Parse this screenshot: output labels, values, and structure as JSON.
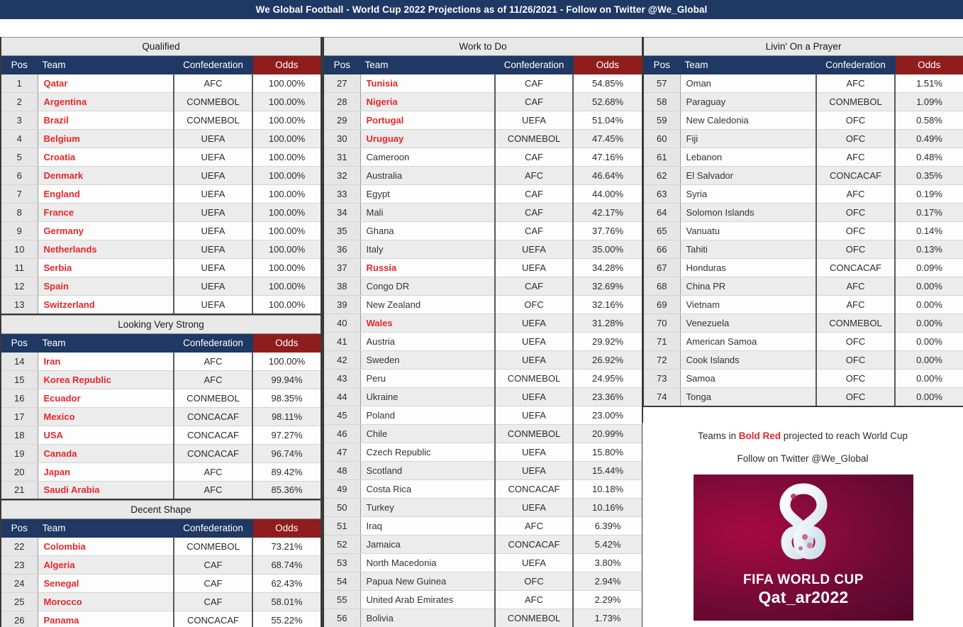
{
  "title": "We Global Football - World Cup 2022 Projections as of 11/26/2021 - Follow on Twitter @We_Global",
  "colors": {
    "header_blue": "#1f3864",
    "odds_red": "#8f1d1d",
    "bold_red": "#e8262a",
    "section_band": "#e8e8e8",
    "row_alt": "#ececec"
  },
  "columns": {
    "pos": "Pos",
    "team": "Team",
    "confederation": "Confederation",
    "odds": "Odds"
  },
  "sections": [
    {
      "name": "Qualified",
      "column": "left",
      "rows": [
        {
          "pos": "1",
          "team": "Qatar",
          "conf": "AFC",
          "odds": "100.00%",
          "red": true
        },
        {
          "pos": "2",
          "team": "Argentina",
          "conf": "CONMEBOL",
          "odds": "100.00%",
          "red": true
        },
        {
          "pos": "3",
          "team": "Brazil",
          "conf": "CONMEBOL",
          "odds": "100.00%",
          "red": true
        },
        {
          "pos": "4",
          "team": "Belgium",
          "conf": "UEFA",
          "odds": "100.00%",
          "red": true
        },
        {
          "pos": "5",
          "team": "Croatia",
          "conf": "UEFA",
          "odds": "100.00%",
          "red": true
        },
        {
          "pos": "6",
          "team": "Denmark",
          "conf": "UEFA",
          "odds": "100.00%",
          "red": true
        },
        {
          "pos": "7",
          "team": "England",
          "conf": "UEFA",
          "odds": "100.00%",
          "red": true
        },
        {
          "pos": "8",
          "team": "France",
          "conf": "UEFA",
          "odds": "100.00%",
          "red": true
        },
        {
          "pos": "9",
          "team": "Germany",
          "conf": "UEFA",
          "odds": "100.00%",
          "red": true
        },
        {
          "pos": "10",
          "team": "Netherlands",
          "conf": "UEFA",
          "odds": "100.00%",
          "red": true
        },
        {
          "pos": "11",
          "team": "Serbia",
          "conf": "UEFA",
          "odds": "100.00%",
          "red": true
        },
        {
          "pos": "12",
          "team": "Spain",
          "conf": "UEFA",
          "odds": "100.00%",
          "red": true
        },
        {
          "pos": "13",
          "team": "Switzerland",
          "conf": "UEFA",
          "odds": "100.00%",
          "red": true
        }
      ]
    },
    {
      "name": "Looking Very Strong",
      "column": "left",
      "rows": [
        {
          "pos": "14",
          "team": "Iran",
          "conf": "AFC",
          "odds": "100.00%",
          "red": true
        },
        {
          "pos": "15",
          "team": "Korea Republic",
          "conf": "AFC",
          "odds": "99.94%",
          "red": true
        },
        {
          "pos": "16",
          "team": "Ecuador",
          "conf": "CONMEBOL",
          "odds": "98.35%",
          "red": true
        },
        {
          "pos": "17",
          "team": "Mexico",
          "conf": "CONCACAF",
          "odds": "98.11%",
          "red": true
        },
        {
          "pos": "18",
          "team": "USA",
          "conf": "CONCACAF",
          "odds": "97.27%",
          "red": true
        },
        {
          "pos": "19",
          "team": "Canada",
          "conf": "CONCACAF",
          "odds": "96.74%",
          "red": true
        },
        {
          "pos": "20",
          "team": "Japan",
          "conf": "AFC",
          "odds": "89.42%",
          "red": true
        },
        {
          "pos": "21",
          "team": "Saudi Arabia",
          "conf": "AFC",
          "odds": "85.36%",
          "red": true
        }
      ]
    },
    {
      "name": "Decent Shape",
      "column": "left",
      "rows": [
        {
          "pos": "22",
          "team": "Colombia",
          "conf": "CONMEBOL",
          "odds": "73.21%",
          "red": true
        },
        {
          "pos": "23",
          "team": "Algeria",
          "conf": "CAF",
          "odds": "68.74%",
          "red": true
        },
        {
          "pos": "24",
          "team": "Senegal",
          "conf": "CAF",
          "odds": "62.43%",
          "red": true
        },
        {
          "pos": "25",
          "team": "Morocco",
          "conf": "CAF",
          "odds": "58.01%",
          "red": true
        },
        {
          "pos": "26",
          "team": "Panama",
          "conf": "CONCACAF",
          "odds": "55.22%",
          "red": true
        }
      ]
    },
    {
      "name": "Work to Do",
      "column": "mid",
      "rows": [
        {
          "pos": "27",
          "team": "Tunisia",
          "conf": "CAF",
          "odds": "54.85%",
          "red": true
        },
        {
          "pos": "28",
          "team": "Nigeria",
          "conf": "CAF",
          "odds": "52.68%",
          "red": true
        },
        {
          "pos": "29",
          "team": "Portugal",
          "conf": "UEFA",
          "odds": "51.04%",
          "red": true
        },
        {
          "pos": "30",
          "team": "Uruguay",
          "conf": "CONMEBOL",
          "odds": "47.45%",
          "red": true
        },
        {
          "pos": "31",
          "team": "Cameroon",
          "conf": "CAF",
          "odds": "47.16%",
          "red": false
        },
        {
          "pos": "32",
          "team": "Australia",
          "conf": "AFC",
          "odds": "46.64%",
          "red": false
        },
        {
          "pos": "33",
          "team": "Egypt",
          "conf": "CAF",
          "odds": "44.00%",
          "red": false
        },
        {
          "pos": "34",
          "team": "Mali",
          "conf": "CAF",
          "odds": "42.17%",
          "red": false
        },
        {
          "pos": "35",
          "team": "Ghana",
          "conf": "CAF",
          "odds": "37.76%",
          "red": false
        },
        {
          "pos": "36",
          "team": "Italy",
          "conf": "UEFA",
          "odds": "35.00%",
          "red": false
        },
        {
          "pos": "37",
          "team": "Russia",
          "conf": "UEFA",
          "odds": "34.28%",
          "red": true
        },
        {
          "pos": "38",
          "team": "Congo DR",
          "conf": "CAF",
          "odds": "32.69%",
          "red": false
        },
        {
          "pos": "39",
          "team": "New Zealand",
          "conf": "OFC",
          "odds": "32.16%",
          "red": false
        },
        {
          "pos": "40",
          "team": "Wales",
          "conf": "UEFA",
          "odds": "31.28%",
          "red": true
        },
        {
          "pos": "41",
          "team": "Austria",
          "conf": "UEFA",
          "odds": "29.92%",
          "red": false
        },
        {
          "pos": "42",
          "team": "Sweden",
          "conf": "UEFA",
          "odds": "26.92%",
          "red": false
        },
        {
          "pos": "43",
          "team": "Peru",
          "conf": "CONMEBOL",
          "odds": "24.95%",
          "red": false
        },
        {
          "pos": "44",
          "team": "Ukraine",
          "conf": "UEFA",
          "odds": "23.36%",
          "red": false
        },
        {
          "pos": "45",
          "team": "Poland",
          "conf": "UEFA",
          "odds": "23.00%",
          "red": false
        },
        {
          "pos": "46",
          "team": "Chile",
          "conf": "CONMEBOL",
          "odds": "20.99%",
          "red": false
        },
        {
          "pos": "47",
          "team": "Czech Republic",
          "conf": "UEFA",
          "odds": "15.80%",
          "red": false
        },
        {
          "pos": "48",
          "team": "Scotland",
          "conf": "UEFA",
          "odds": "15.44%",
          "red": false
        },
        {
          "pos": "49",
          "team": "Costa Rica",
          "conf": "CONCACAF",
          "odds": "10.18%",
          "red": false
        },
        {
          "pos": "50",
          "team": "Turkey",
          "conf": "UEFA",
          "odds": "10.16%",
          "red": false
        },
        {
          "pos": "51",
          "team": "Iraq",
          "conf": "AFC",
          "odds": "6.39%",
          "red": false
        },
        {
          "pos": "52",
          "team": "Jamaica",
          "conf": "CONCACAF",
          "odds": "5.42%",
          "red": false
        },
        {
          "pos": "53",
          "team": "North Macedonia",
          "conf": "UEFA",
          "odds": "3.80%",
          "red": false
        },
        {
          "pos": "54",
          "team": "Papua New Guinea",
          "conf": "OFC",
          "odds": "2.94%",
          "red": false
        },
        {
          "pos": "55",
          "team": "United Arab Emirates",
          "conf": "AFC",
          "odds": "2.29%",
          "red": false
        },
        {
          "pos": "56",
          "team": "Bolivia",
          "conf": "CONMEBOL",
          "odds": "1.73%",
          "red": false
        }
      ]
    },
    {
      "name": "Livin' On a Prayer",
      "column": "right",
      "rows": [
        {
          "pos": "57",
          "team": "Oman",
          "conf": "AFC",
          "odds": "1.51%",
          "red": false
        },
        {
          "pos": "58",
          "team": "Paraguay",
          "conf": "CONMEBOL",
          "odds": "1.09%",
          "red": false
        },
        {
          "pos": "59",
          "team": "New Caledonia",
          "conf": "OFC",
          "odds": "0.58%",
          "red": false
        },
        {
          "pos": "60",
          "team": "Fiji",
          "conf": "OFC",
          "odds": "0.49%",
          "red": false
        },
        {
          "pos": "61",
          "team": "Lebanon",
          "conf": "AFC",
          "odds": "0.48%",
          "red": false
        },
        {
          "pos": "62",
          "team": "El Salvador",
          "conf": "CONCACAF",
          "odds": "0.35%",
          "red": false
        },
        {
          "pos": "63",
          "team": "Syria",
          "conf": "AFC",
          "odds": "0.19%",
          "red": false
        },
        {
          "pos": "64",
          "team": "Solomon Islands",
          "conf": "OFC",
          "odds": "0.17%",
          "red": false
        },
        {
          "pos": "65",
          "team": "Vanuatu",
          "conf": "OFC",
          "odds": "0.14%",
          "red": false
        },
        {
          "pos": "66",
          "team": "Tahiti",
          "conf": "OFC",
          "odds": "0.13%",
          "red": false
        },
        {
          "pos": "67",
          "team": "Honduras",
          "conf": "CONCACAF",
          "odds": "0.09%",
          "red": false
        },
        {
          "pos": "68",
          "team": "China PR",
          "conf": "AFC",
          "odds": "0.00%",
          "red": false
        },
        {
          "pos": "69",
          "team": "Vietnam",
          "conf": "AFC",
          "odds": "0.00%",
          "red": false
        },
        {
          "pos": "70",
          "team": "Venezuela",
          "conf": "CONMEBOL",
          "odds": "0.00%",
          "red": false
        },
        {
          "pos": "71",
          "team": "American Samoa",
          "conf": "OFC",
          "odds": "0.00%",
          "red": false
        },
        {
          "pos": "72",
          "team": "Cook Islands",
          "conf": "OFC",
          "odds": "0.00%",
          "red": false
        },
        {
          "pos": "73",
          "team": "Samoa",
          "conf": "OFC",
          "odds": "0.00%",
          "red": false
        },
        {
          "pos": "74",
          "team": "Tonga",
          "conf": "OFC",
          "odds": "0.00%",
          "red": false
        }
      ]
    }
  ],
  "footer": {
    "note_prefix": "Teams in ",
    "note_highlight": "Bold Red",
    "note_suffix": " projected to reach World Cup",
    "note_line2": "Follow on Twitter @We_Global",
    "logo": {
      "line1": "FIFA WORLD CUP",
      "line2": "Qat_ar2022"
    }
  }
}
